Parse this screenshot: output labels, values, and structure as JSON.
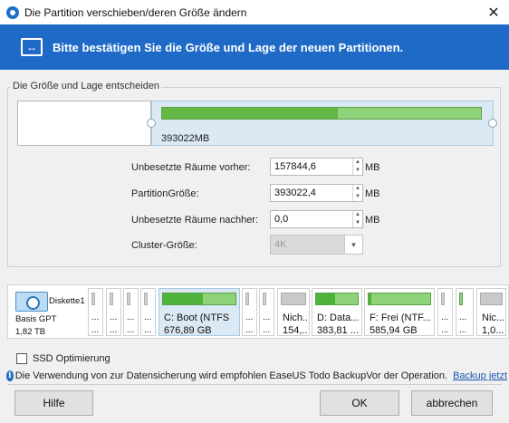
{
  "window": {
    "title": "Die Partition verschieben/deren Größe ändern",
    "close_glyph": "✕"
  },
  "banner": {
    "text": "Bitte bestätigen Sie die Größe und Lage der neuen Partitionen.",
    "icon": "resize-arrows-icon",
    "color": "#1e6ac6"
  },
  "group": {
    "legend": "Die Größe und Lage entscheiden",
    "partition_size_label": "393022MB",
    "partition_used_fraction": 0.55
  },
  "fields": {
    "before_label": "Unbesetzte Räume vorher:",
    "before_value": "157844,6",
    "size_label": "PartitionGröße:",
    "size_value": "393022,4",
    "after_label": "Unbesetzte Räume nachher:",
    "after_value": "0,0",
    "cluster_label": "Cluster-Größe:",
    "cluster_value": "4K",
    "unit": "MB"
  },
  "disk": {
    "name": "Diskette1",
    "type": "Basis GPT",
    "size": "1,82 TB",
    "partitions": [
      {
        "line1": "...",
        "line2": "...",
        "kind": "narrow",
        "used": 0
      },
      {
        "line1": "...",
        "line2": "...",
        "kind": "narrow",
        "used": 0
      },
      {
        "line1": "...",
        "line2": "...",
        "kind": "narrow",
        "used": 0
      },
      {
        "line1": "...",
        "line2": "...",
        "kind": "narrow",
        "used": 0
      },
      {
        "line1": "C: Boot (NTFS",
        "line2": "676,89 GB",
        "kind": "green",
        "used": 0.55
      },
      {
        "line1": "...",
        "line2": "...",
        "kind": "narrow",
        "used": 0
      },
      {
        "line1": "...",
        "line2": "...",
        "kind": "narrow",
        "used": 0
      },
      {
        "line1": "Nich...",
        "line2": "154,...",
        "kind": "gray",
        "used": 0
      },
      {
        "line1": "D: Data...",
        "line2": "383,81 ...",
        "kind": "green",
        "used": 0.45
      },
      {
        "line1": "F: Frei (NTF...",
        "line2": "585,94 GB",
        "kind": "green",
        "used": 0.05
      },
      {
        "line1": "...",
        "line2": "...",
        "kind": "narrow",
        "used": 0
      },
      {
        "line1": "...",
        "line2": "...",
        "kind": "narrow-green",
        "used": 0
      },
      {
        "line1": "Nic...",
        "line2": "1,0...",
        "kind": "gray",
        "used": 0
      }
    ]
  },
  "ssd": {
    "label": "SSD Optimierung",
    "checked": false
  },
  "info": {
    "text": "Die Verwendung von zur Datensicherung wird empfohlen EaseUS Todo BackupVor der Operation.",
    "link": "Backup jetzt"
  },
  "buttons": {
    "help": "Hilfe",
    "ok": "OK",
    "cancel": "abbrechen"
  }
}
